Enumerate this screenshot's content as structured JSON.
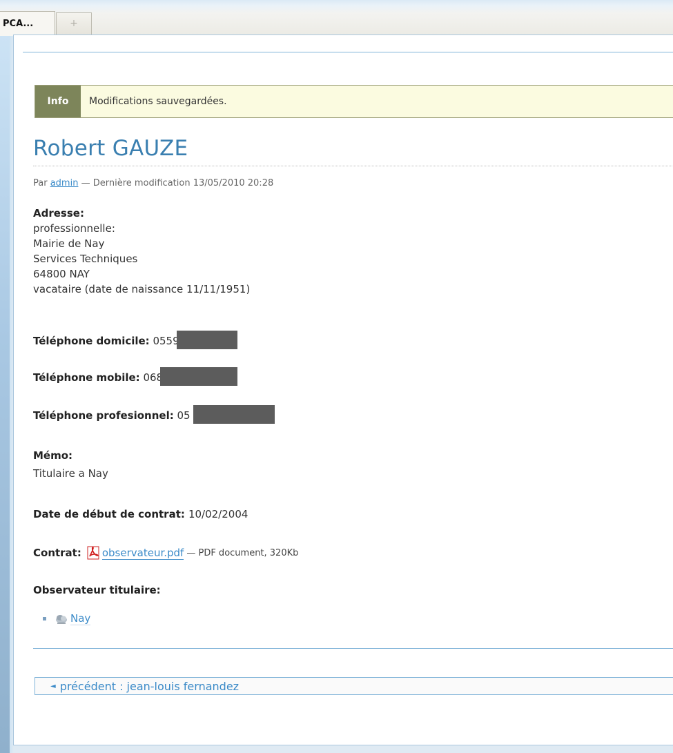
{
  "browser": {
    "active_tab_label": "PCA...",
    "new_tab_glyph": "+"
  },
  "info_banner": {
    "label": "Info",
    "message": "Modifications sauvegardées."
  },
  "person": {
    "name": "Robert GAUZE",
    "byline": {
      "prefix": "Par",
      "author": "admin",
      "suffix": "— Dernière modification 13/05/2010 20:28"
    }
  },
  "address": {
    "label": "Adresse:",
    "lines": [
      "professionnelle:",
      "Mairie de Nay",
      "Services Techniques",
      "64800 NAY",
      "vacataire (date de naissance 11/11/1951)"
    ]
  },
  "phones": [
    {
      "label": "Téléphone domicile:",
      "value": "0559"
    },
    {
      "label": "Téléphone mobile:",
      "value": "068"
    },
    {
      "label": "Téléphone profesionnel:",
      "value": "05"
    }
  ],
  "memo": {
    "label": "Mémo:",
    "value": "Titulaire a Nay"
  },
  "contract_start": {
    "label": "Date de début de contrat:",
    "value": "10/02/2004"
  },
  "contract": {
    "label": "Contrat:",
    "file_name": "observateur.pdf",
    "meta": "— PDF document, 320Kb",
    "icon": "pdf-icon"
  },
  "observer": {
    "label": "Observateur titulaire:",
    "items": [
      {
        "name": "Nay",
        "icon": "weather-station-icon"
      }
    ]
  },
  "navigation": {
    "previous_label": "précédent : jean-louis fernandez"
  },
  "colors": {
    "link": "#3a8ac8",
    "title": "#3a7fb0",
    "info_label_bg": "#7d855a",
    "info_bg": "#fbfbe0",
    "redaction": "#5c5c5c"
  }
}
